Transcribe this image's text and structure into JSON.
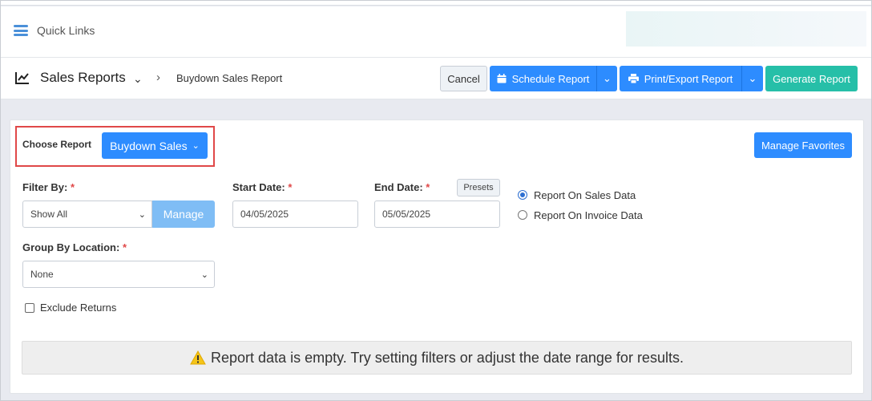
{
  "quick_links": {
    "label": "Quick Links",
    "icon": "hamburger-menu-icon"
  },
  "header": {
    "title": "Sales Reports",
    "breadcrumb": "Buydown Sales Report",
    "icon": "line-chart-icon"
  },
  "toolbar": {
    "cancel_label": "Cancel",
    "schedule_label": "Schedule Report",
    "print_label": "Print/Export Report",
    "generate_label": "Generate Report"
  },
  "choose_report": {
    "label": "Choose Report",
    "value": "Buydown Sales",
    "manage_favorites_label": "Manage Favorites"
  },
  "filters": {
    "filter_by_label": "Filter By:",
    "filter_by_value": "Show All",
    "manage_label": "Manage",
    "start_date_label": "Start Date:",
    "start_date_value": "04/05/2025",
    "end_date_label": "End Date:",
    "end_date_value": "05/05/2025",
    "presets_label": "Presets",
    "report_on_sales": "Report On Sales Data",
    "report_on_invoice": "Report On Invoice Data",
    "selected_report_on": "sales",
    "group_by_label": "Group By Location:",
    "group_by_value": "None",
    "exclude_returns_label": "Exclude Returns",
    "exclude_returns_checked": false,
    "required_mark": "*"
  },
  "message": {
    "empty_text": "Report data is empty. Try setting filters or adjust the date range for results.",
    "icon": "warning-icon"
  },
  "colors": {
    "primary": "#2d8cff",
    "success": "#26bfa8",
    "highlight_border": "#e04848",
    "warning": "#f5c518"
  }
}
